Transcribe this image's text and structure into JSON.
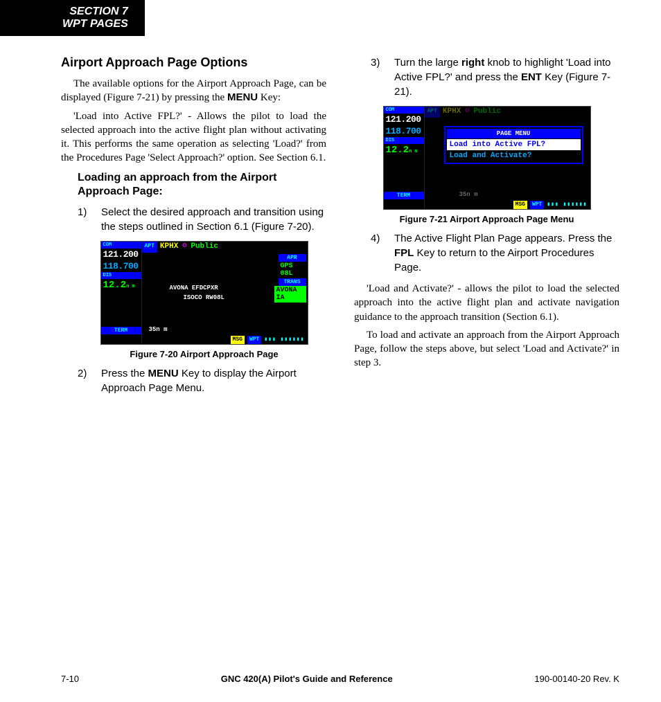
{
  "header": {
    "line1": "SECTION 7",
    "line2": "WPT PAGES"
  },
  "left": {
    "h2": "Airport Approach Page Options",
    "p1a": "The available options for the Airport Approach Page, can be displayed (Figure 7-21) by pressing the ",
    "p1_key": "MENU",
    "p1b": " Key:",
    "p2": "'Load into Active FPL?' - Allows the pilot to load the selected approach into the active flight plan without activating it.  This performs the same operation as selecting 'Load?' from the Procedures Page 'Select Approach?' option.  See Section 6.1.",
    "subh": "Loading an approach from the Airport Approach Page:",
    "step1_num": "1)",
    "step1": "Select the desired approach and transition using the steps outlined in Section 6.1 (Figure 7-20).",
    "fig20_caption": "Figure 7-20  Airport Approach Page",
    "step2_num": "2)",
    "step2a": "Press the ",
    "step2_key": "MENU",
    "step2b": " Key to display the Airport Approach Page Menu."
  },
  "right": {
    "step3_num": "3)",
    "step3a": "Turn the large ",
    "step3_key1": "right",
    "step3b": " knob to highlight 'Load into Active FPL?' and press the ",
    "step3_key2": "ENT",
    "step3c": " Key (Figure 7-21).",
    "fig21_caption": "Figure 7-21  Airport Approach Page Menu",
    "step4_num": "4)",
    "step4a": "The Active Flight Plan Page appears.  Press the ",
    "step4_key": "FPL",
    "step4b": " Key to return to the Airport Procedures Page.",
    "p3": "'Load and Activate?' - allows the pilot to load the selected approach into the active flight plan and activate navigation guidance to the approach transition (Section 6.1).",
    "p4": "To load and activate an approach from the Airport Approach Page, follow the steps above, but select 'Load and Activate?' in step 3."
  },
  "gps20": {
    "com": "COM",
    "freq1": "121.200",
    "freq2": "118.700",
    "dis": "DIS",
    "disv": "12.2",
    "disu": "n m",
    "term": "TERM",
    "apt_tag": "APT",
    "apt": "KPHX",
    "pub": "Public",
    "apr_tag": "APR",
    "apr": "GPS 08L",
    "trans_tag": "TRANS",
    "trans": "AVONA IA",
    "mid1": "AVONA EFDCPXR",
    "mid2": "ISOCO RW08L",
    "scale": "35n m",
    "msg": "MSG",
    "wpt": "WPT"
  },
  "gps21": {
    "com": "COM",
    "freq1": "121.200",
    "freq2": "118.700",
    "dis": "DIS",
    "disv": "12.2",
    "disu": "n m",
    "term": "TERM",
    "apt_tag": "APT",
    "apt": "KPHX",
    "pub": "Public",
    "menu_title": "PAGE MENU",
    "menu1": "Load into Active FPL?",
    "menu2": "Load and Activate?",
    "scale": "35n m",
    "msg": "MSG",
    "wpt": "WPT"
  },
  "footer": {
    "left": "7-10",
    "mid": "GNC 420(A) Pilot's Guide and Reference",
    "right": "190-00140-20  Rev. K"
  }
}
